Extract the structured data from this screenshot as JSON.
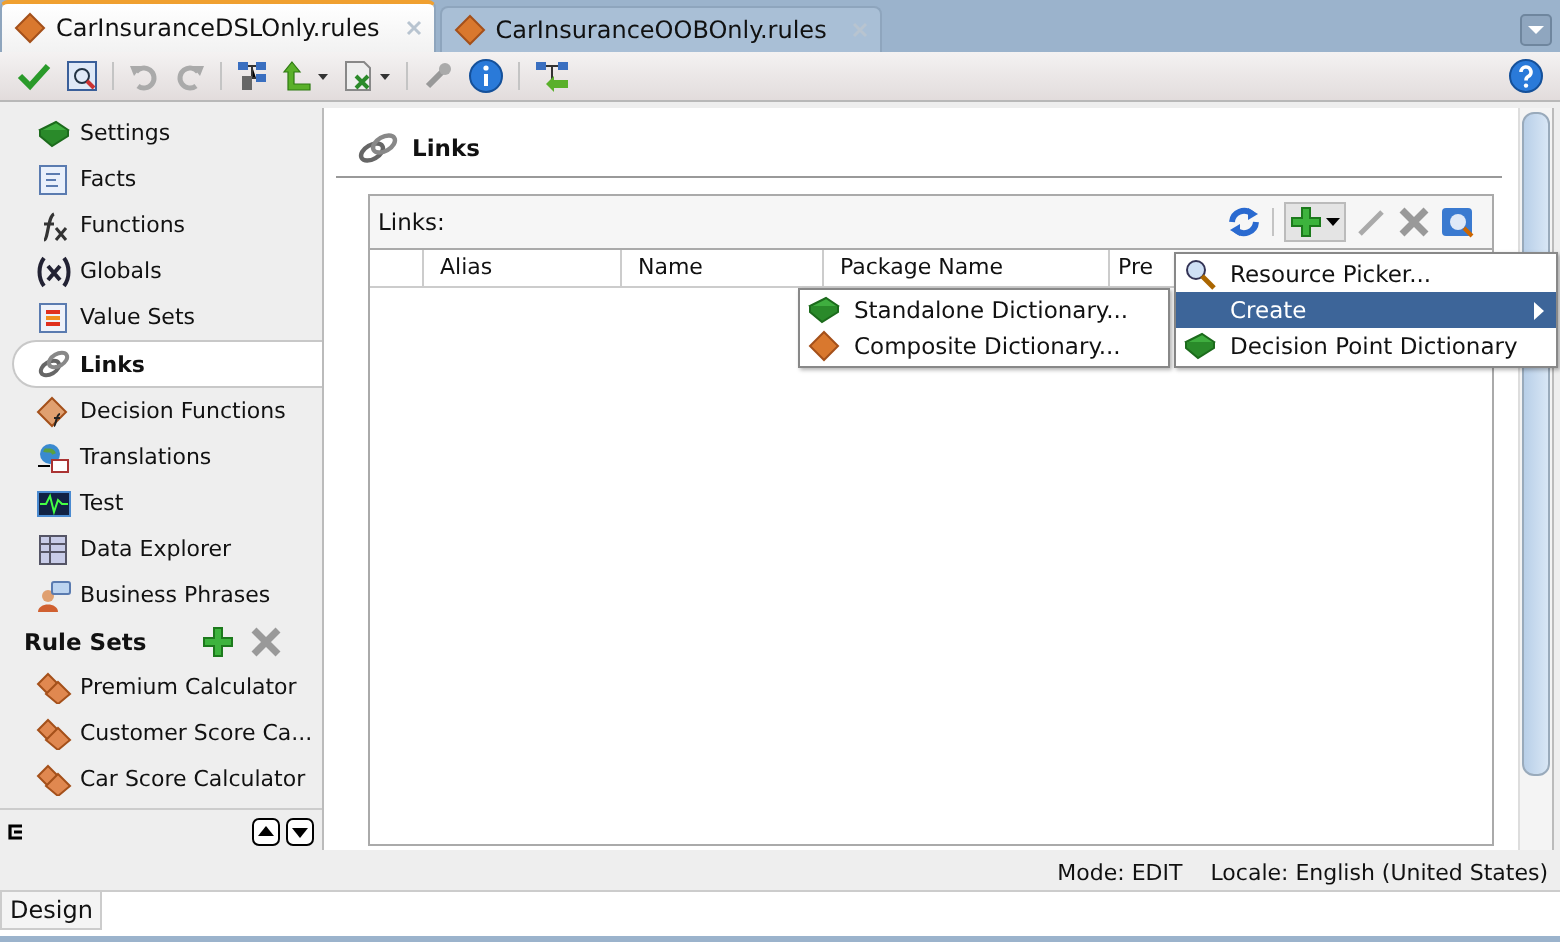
{
  "tabs": [
    {
      "label": "CarInsuranceDSLOnly.rules",
      "selected": true
    },
    {
      "label": "CarInsuranceOOBOnly.rules",
      "selected": false
    }
  ],
  "sidebar": {
    "items": [
      {
        "label": "Settings",
        "selected": false
      },
      {
        "label": "Facts",
        "selected": false
      },
      {
        "label": "Functions",
        "selected": false
      },
      {
        "label": "Globals",
        "selected": false
      },
      {
        "label": "Value Sets",
        "selected": false
      },
      {
        "label": "Links",
        "selected": true
      },
      {
        "label": "Decision Functions",
        "selected": false
      },
      {
        "label": "Translations",
        "selected": false
      },
      {
        "label": "Test",
        "selected": false
      },
      {
        "label": "Data Explorer",
        "selected": false
      },
      {
        "label": "Business Phrases",
        "selected": false
      }
    ],
    "rule_sets": {
      "title": "Rule Sets",
      "items": [
        {
          "label": "Premium Calculator"
        },
        {
          "label": "Customer Score Ca..."
        },
        {
          "label": "Car Score Calculator"
        }
      ]
    }
  },
  "panel": {
    "title": "Links",
    "table": {
      "label": "Links:",
      "columns": [
        "Alias",
        "Name",
        "Package Name",
        "Pre"
      ]
    }
  },
  "menu": {
    "items": [
      {
        "label": "Resource Picker...",
        "kind": "item",
        "selected": false
      },
      {
        "label": "Create",
        "kind": "submenu",
        "selected": true
      },
      {
        "label": "Decision Point Dictionary",
        "kind": "item",
        "selected": false
      }
    ]
  },
  "submenu": {
    "items": [
      {
        "label": "Standalone Dictionary..."
      },
      {
        "label": "Composite Dictionary..."
      }
    ]
  },
  "status_bar": {
    "mode": "Mode: EDIT",
    "locale": "Locale: English (United States)"
  },
  "bottom_tabs": [
    {
      "label": "Design",
      "selected": true
    }
  ]
}
